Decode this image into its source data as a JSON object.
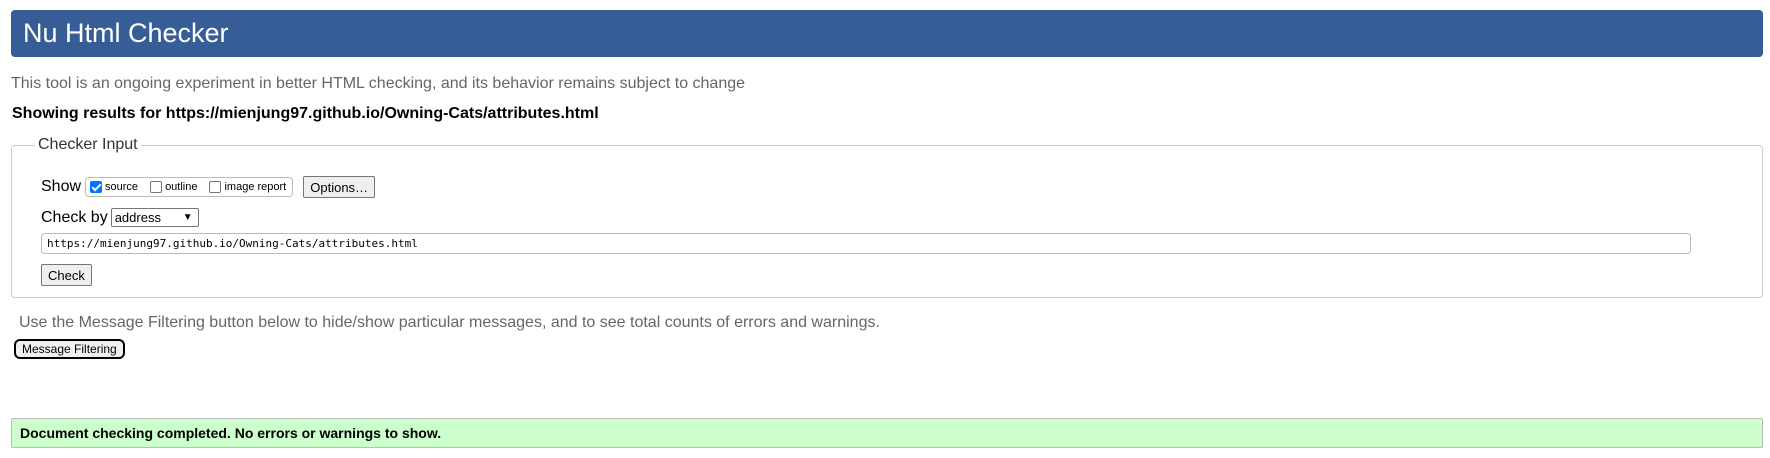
{
  "header": {
    "title": "Nu Html Checker"
  },
  "intro": {
    "subtitle": "This tool is an ongoing experiment in better HTML checking, and its behavior remains subject to change",
    "results_for": "Showing results for https://mienjung97.github.io/Owning-Cats/attributes.html"
  },
  "checker_input": {
    "legend": "Checker Input",
    "show_label": "Show",
    "show_options": [
      {
        "label": "source",
        "checked": true
      },
      {
        "label": "outline",
        "checked": false
      },
      {
        "label": "image report",
        "checked": false
      }
    ],
    "options_button": "Options…",
    "check_by_label": "Check by",
    "check_by_selected": "address",
    "url_value": "https://mienjung97.github.io/Owning-Cats/attributes.html",
    "check_button": "Check"
  },
  "filtering": {
    "note": "Use the Message Filtering button below to hide/show particular messages, and to see total counts of errors and warnings.",
    "button_label": "Message Filtering"
  },
  "result": {
    "message": "Document checking completed. No errors or warnings to show.",
    "color": "#ccffcc"
  },
  "colors": {
    "header_bg": "#365d95"
  }
}
